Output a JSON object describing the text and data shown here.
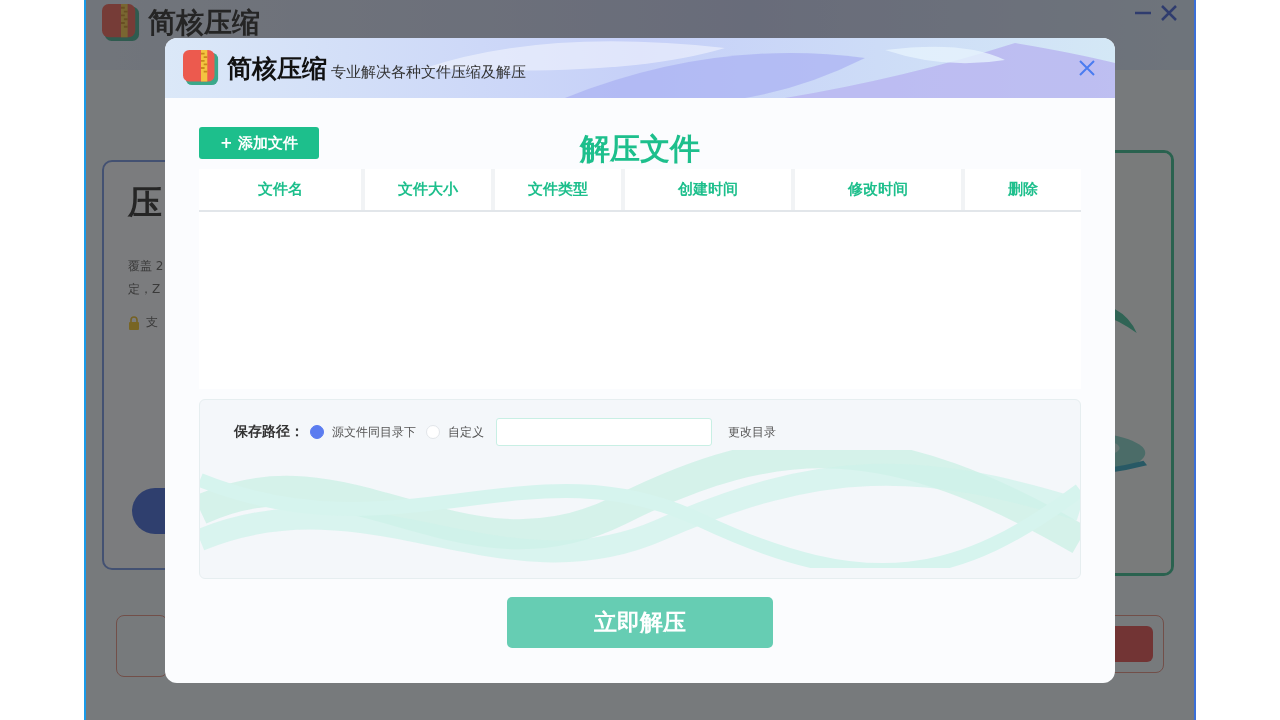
{
  "background_app": {
    "title": "简核压缩",
    "card": {
      "heading": "压",
      "lines": [
        "覆盖 2",
        "定，Z"
      ],
      "note": "支"
    }
  },
  "dialog": {
    "brand": "简核压缩",
    "slogan": "专业解决各种文件压缩及解压",
    "add_button": "+ 添加文件",
    "title": "解压文件",
    "columns": [
      "文件名",
      "文件大小",
      "文件类型",
      "创建时间",
      "修改时间",
      "删除"
    ],
    "save_path": {
      "label": "保存路径：",
      "options": [
        {
          "label": "源文件同目录下",
          "selected": true
        },
        {
          "label": "自定义",
          "selected": false
        }
      ],
      "change_button": "更改目录"
    },
    "submit": "立即解压"
  }
}
